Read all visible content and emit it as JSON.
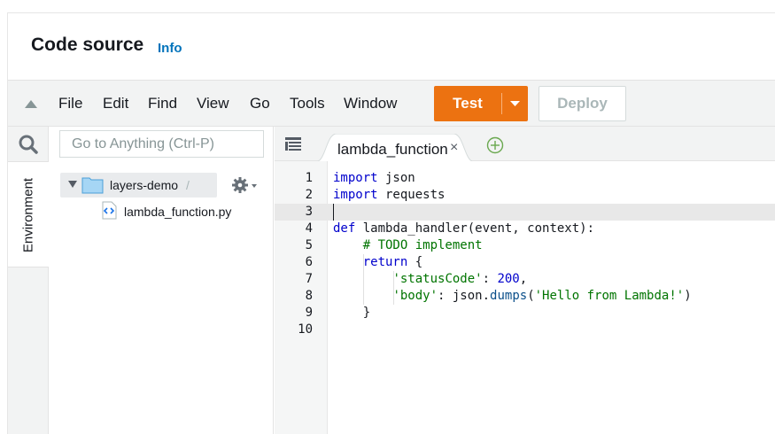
{
  "header": {
    "title": "Code source",
    "info_link": "Info"
  },
  "menubar": {
    "items": [
      "File",
      "Edit",
      "Find",
      "View",
      "Go",
      "Tools",
      "Window"
    ],
    "test_label": "Test",
    "deploy_label": "Deploy"
  },
  "sidebar": {
    "environment_tab": "Environment"
  },
  "filetree": {
    "search_placeholder": "Go to Anything (Ctrl-P)",
    "root_folder": "layers-demo",
    "root_suffix": "/",
    "files": [
      "lambda_function.py"
    ]
  },
  "editor": {
    "tab_label": "lambda_function",
    "tab_close": "×",
    "line_numbers": [
      "1",
      "2",
      "3",
      "4",
      "5",
      "6",
      "7",
      "8",
      "9",
      "10"
    ],
    "active_line": 3
  },
  "colors": {
    "accent_orange": "#ec7211",
    "link_blue": "#0073bb",
    "keyword_blue": "#0000cc",
    "string_green": "#007400"
  }
}
